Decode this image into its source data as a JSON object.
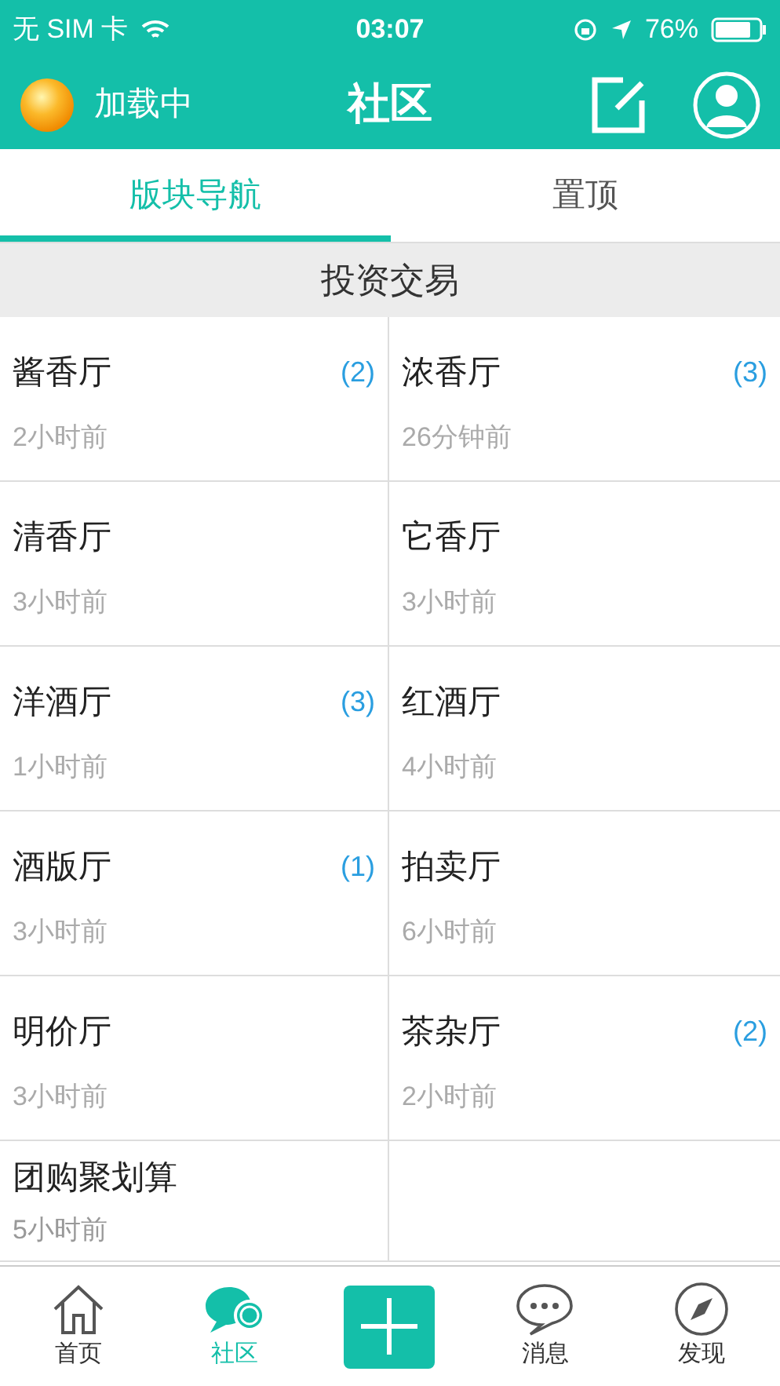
{
  "status_bar": {
    "carrier": "无 SIM 卡",
    "time": "03:07",
    "battery": "76%"
  },
  "nav_bar": {
    "loading": "加载中",
    "title": "社区"
  },
  "tabs": [
    {
      "label": "版块导航",
      "selected": true
    },
    {
      "label": "置顶",
      "selected": false
    }
  ],
  "section": {
    "title": "投资交易"
  },
  "forums": [
    {
      "name": "酱香厅",
      "count": "(2)",
      "time": "2小时前"
    },
    {
      "name": "浓香厅",
      "count": "(3)",
      "time": "26分钟前"
    },
    {
      "name": "清香厅",
      "time": "3小时前"
    },
    {
      "name": "它香厅",
      "time": "3小时前"
    },
    {
      "name": "洋酒厅",
      "count": "(3)",
      "time": "1小时前"
    },
    {
      "name": "红酒厅",
      "time": "4小时前"
    },
    {
      "name": "酒版厅",
      "count": "(1)",
      "time": "3小时前"
    },
    {
      "name": "拍卖厅",
      "time": "6小时前"
    },
    {
      "name": "明价厅",
      "time": "3小时前"
    },
    {
      "name": "茶杂厅",
      "count": "(2)",
      "time": "2小时前"
    },
    {
      "name": "团购聚划算",
      "time": "5小时前"
    }
  ],
  "tab_bar": [
    {
      "kind": "home",
      "label": "首页",
      "selected": false
    },
    {
      "kind": "community",
      "label": "社区",
      "selected": true
    },
    {
      "kind": "add"
    },
    {
      "kind": "messages",
      "label": "消息",
      "selected": false
    },
    {
      "kind": "discover",
      "label": "发现",
      "selected": false
    }
  ]
}
